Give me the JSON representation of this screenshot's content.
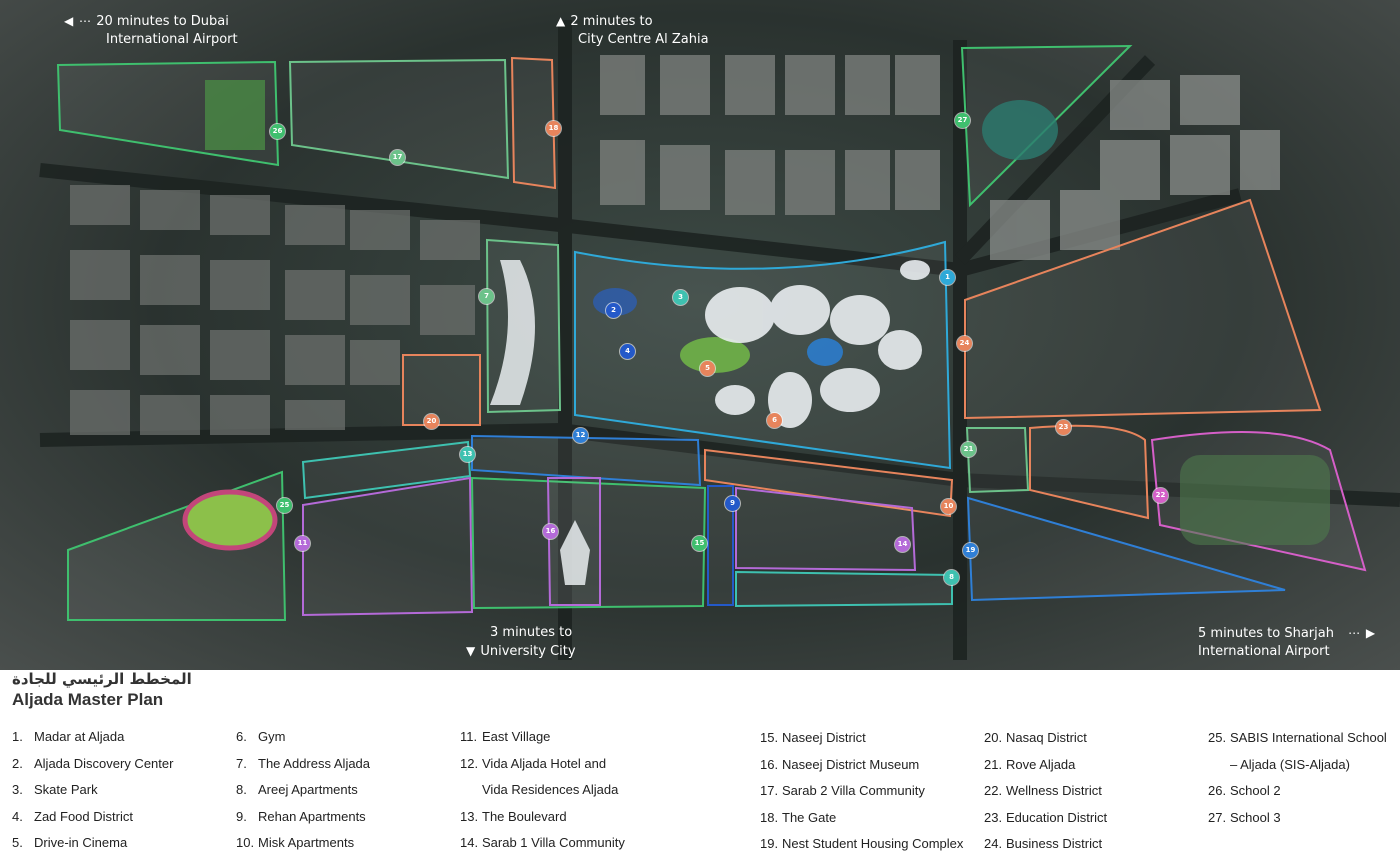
{
  "map": {
    "directions": [
      {
        "arrow": "◀ ⋯",
        "line1": "20 minutes to Dubai",
        "line2": "International Airport"
      },
      {
        "arrow": "▲",
        "line1": "2 minutes to",
        "line2": "City Centre Al Zahia"
      },
      {
        "arrow": "▼",
        "line1": "3 minutes to",
        "line2": "University City"
      },
      {
        "arrow": "⋯ ▶",
        "line1": "5 minutes to Sharjah",
        "line2": "International Airport"
      }
    ],
    "colors": {
      "teal": "#3ec1b0",
      "blue": "#2f7fd6",
      "orange": "#e7845c",
      "green": "#6cc28a",
      "purple": "#b46ad8",
      "pink": "#d55fc8",
      "cyan": "#46b7e6"
    },
    "markers": [
      {
        "n": "1",
        "color": "#2fa9d8"
      },
      {
        "n": "2",
        "color": "#2459c9"
      },
      {
        "n": "3",
        "color": "#3ec1b0"
      },
      {
        "n": "4",
        "color": "#2459c9"
      },
      {
        "n": "5",
        "color": "#e7845c"
      },
      {
        "n": "6",
        "color": "#e7845c"
      },
      {
        "n": "7",
        "color": "#6cc28a"
      },
      {
        "n": "8",
        "color": "#3ec1b0"
      },
      {
        "n": "9",
        "color": "#2459c9"
      },
      {
        "n": "10",
        "color": "#e7845c"
      },
      {
        "n": "11",
        "color": "#b46ad8"
      },
      {
        "n": "12",
        "color": "#2f7fd6"
      },
      {
        "n": "13",
        "color": "#3ec1b0"
      },
      {
        "n": "14",
        "color": "#b46ad8"
      },
      {
        "n": "15",
        "color": "#3fbf6e"
      },
      {
        "n": "16",
        "color": "#b46ad8"
      },
      {
        "n": "17",
        "color": "#6cc28a"
      },
      {
        "n": "18",
        "color": "#e7845c"
      },
      {
        "n": "19",
        "color": "#2f7fd6"
      },
      {
        "n": "20",
        "color": "#e7845c"
      },
      {
        "n": "21",
        "color": "#6cc28a"
      },
      {
        "n": "22",
        "color": "#d55fc8"
      },
      {
        "n": "23",
        "color": "#e7845c"
      },
      {
        "n": "24",
        "color": "#e7845c"
      },
      {
        "n": "25",
        "color": "#3fbf6e"
      },
      {
        "n": "26",
        "color": "#3fbf6e"
      },
      {
        "n": "27",
        "color": "#3fbf6e"
      }
    ]
  },
  "legend": {
    "title_ar": "المخطط الرئيسي للجادة",
    "title_en": "Aljada Master Plan",
    "columns": [
      [
        {
          "num": "1.",
          "text": "Madar at Aljada"
        },
        {
          "num": "2.",
          "text": "Aljada Discovery Center"
        },
        {
          "num": "3.",
          "text": "Skate Park"
        },
        {
          "num": "4.",
          "text": "Zad Food District"
        },
        {
          "num": "5.",
          "text": "Drive-in Cinema"
        }
      ],
      [
        {
          "num": "6.",
          "text": "Gym"
        },
        {
          "num": "7.",
          "text": "The Address Aljada"
        },
        {
          "num": "8.",
          "text": "Areej Apartments"
        },
        {
          "num": "9.",
          "text": "Rehan Apartments"
        },
        {
          "num": "10.",
          "text": "Misk Apartments"
        }
      ],
      [
        {
          "num": "11.",
          "text": "East Village"
        },
        {
          "num": "12.",
          "text": "Vida Aljada Hotel and"
        },
        {
          "num": "",
          "text": "Vida Residences Aljada"
        },
        {
          "num": "13.",
          "text": "The Boulevard"
        },
        {
          "num": "14.",
          "text": "Sarab 1 Villa Community"
        }
      ],
      [
        {
          "num": "15.",
          "text": "Naseej District"
        },
        {
          "num": "16.",
          "text": "Naseej District Museum"
        },
        {
          "num": "17.",
          "text": "Sarab 2 Villa Community"
        },
        {
          "num": "18.",
          "text": "The Gate"
        },
        {
          "num": "19.",
          "text": "Nest Student Housing Complex"
        }
      ],
      [
        {
          "num": "20.",
          "text": "Nasaq District"
        },
        {
          "num": "21.",
          "text": "Rove Aljada"
        },
        {
          "num": "22.",
          "text": "Wellness District"
        },
        {
          "num": "23.",
          "text": "Education District"
        },
        {
          "num": "24.",
          "text": "Business District"
        }
      ],
      [
        {
          "num": "25.",
          "text": "SABIS International School"
        },
        {
          "num": "",
          "text": "– Aljada (SIS-Aljada)"
        },
        {
          "num": "26.",
          "text": "School 2"
        },
        {
          "num": "27.",
          "text": "School 3"
        }
      ]
    ]
  }
}
